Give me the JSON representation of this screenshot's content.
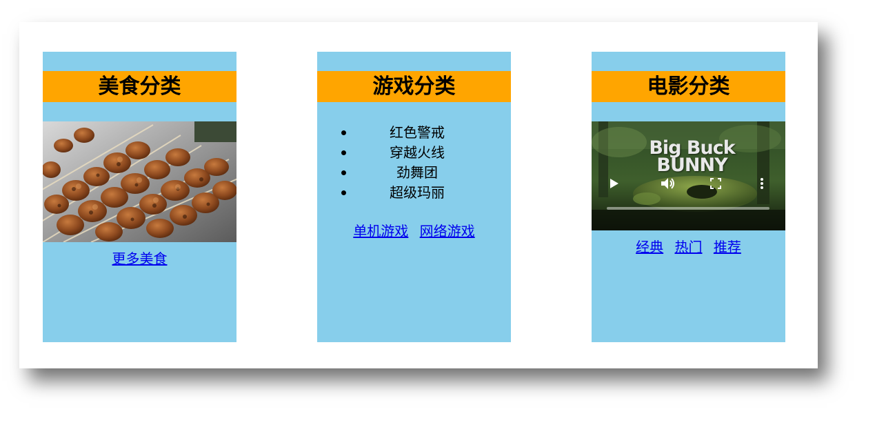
{
  "food": {
    "title": "美食分类",
    "more_link": "更多美食"
  },
  "games": {
    "title": "游戏分类",
    "items": [
      "红色警戒",
      "穿越火线",
      "劲舞团",
      "超级玛丽"
    ],
    "links": [
      "单机游戏",
      "网络游戏"
    ]
  },
  "movies": {
    "title": "电影分类",
    "video": {
      "title_line1": "Big Buck",
      "title_line2": "BUNNY"
    },
    "links": [
      "经典",
      "热门",
      "推荐"
    ]
  },
  "colors": {
    "card_bg": "#87ceeb",
    "title_bar": "#ffa500",
    "link": "#0000ee"
  },
  "icons": [
    "play-icon",
    "volume-icon",
    "fullscreen-icon",
    "more-options-icon"
  ]
}
